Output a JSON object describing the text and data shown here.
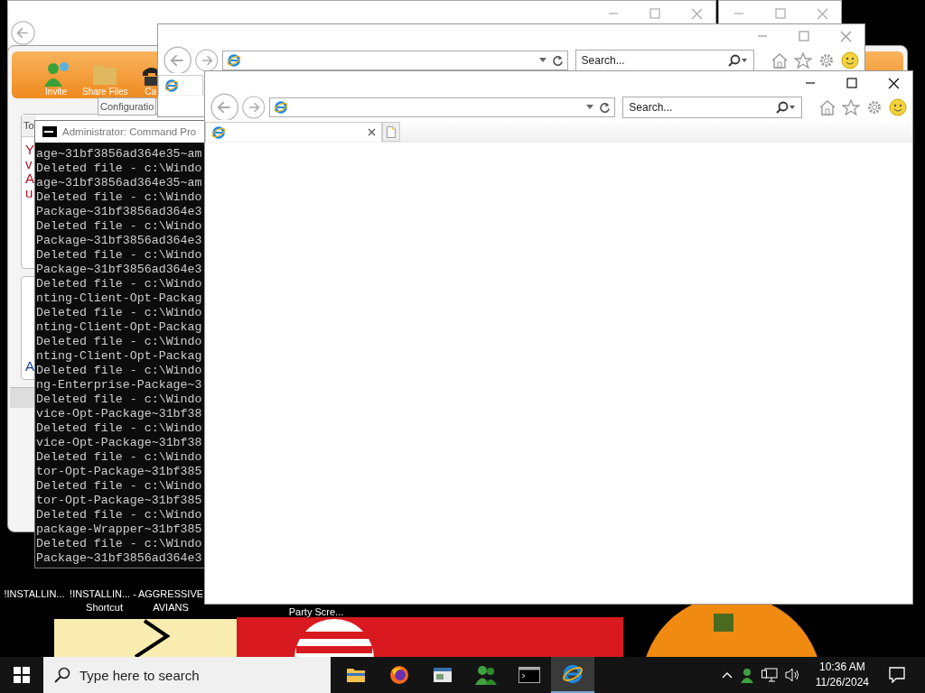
{
  "background_app": {
    "toolbar": [
      {
        "label": "Invite",
        "kind": "person"
      },
      {
        "label": "Share Files",
        "kind": "folder"
      },
      {
        "label": "Ca",
        "kind": "phone"
      }
    ],
    "tooltip": "Configuratio",
    "tab": "To",
    "message_lines": [
      "Y",
      "v",
      "A",
      "u"
    ],
    "footer_letter": "A"
  },
  "browser_windows": [
    {
      "search": {
        "placeholder": "Search..."
      },
      "tab_close": false
    },
    {
      "search": {
        "placeholder": "Search..."
      },
      "tab_close": true
    }
  ],
  "command_prompt": {
    "title": "Administrator: Command Pro",
    "lines": [
      "age~31bf3856ad364e35~am",
      "Deleted file - c:\\Windo",
      "age~31bf3856ad364e35~am",
      "Deleted file - c:\\Windo",
      "Package~31bf3856ad364e3",
      "Deleted file - c:\\Windo",
      "Package~31bf3856ad364e3",
      "Deleted file - c:\\Windo",
      "Package~31bf3856ad364e3",
      "Deleted file - c:\\Windo",
      "nting-Client-Opt-Packag",
      "Deleted file - c:\\Windo",
      "nting-Client-Opt-Packag",
      "Deleted file - c:\\Windo",
      "nting-Client-Opt-Packag",
      "Deleted file - c:\\Windo",
      "ng-Enterprise-Package~3",
      "Deleted file - c:\\Windo",
      "vice-Opt-Package~31bf38",
      "Deleted file - c:\\Windo",
      "vice-Opt-Package~31bf38",
      "Deleted file - c:\\Windo",
      "tor-Opt-Package~31bf385",
      "Deleted file - c:\\Windo",
      "tor-Opt-Package~31bf385",
      "Deleted file - c:\\Windo",
      "package-Wrapper~31bf385",
      "Deleted file - c:\\Windo",
      "Package~31bf3856ad364e3"
    ]
  },
  "desktop_icons": [
    {
      "label": "!INSTALLIN..."
    },
    {
      "label": "!INSTALLIN... - Shortcut"
    },
    {
      "label": "AGGRESSIVE AVIANS"
    },
    {
      "label": "Party Scre..."
    }
  ],
  "taskbar": {
    "search": {
      "placeholder": "Type here to search"
    },
    "apps": [
      {
        "kind": "explorer",
        "selected": false
      },
      {
        "kind": "firefox",
        "selected": false
      },
      {
        "kind": "document",
        "selected": false
      },
      {
        "kind": "people",
        "selected": false
      },
      {
        "kind": "console",
        "selected": false
      },
      {
        "kind": "browser",
        "selected": true
      }
    ],
    "clock": {
      "time": "10:36 AM",
      "date": "11/26/2024"
    }
  }
}
